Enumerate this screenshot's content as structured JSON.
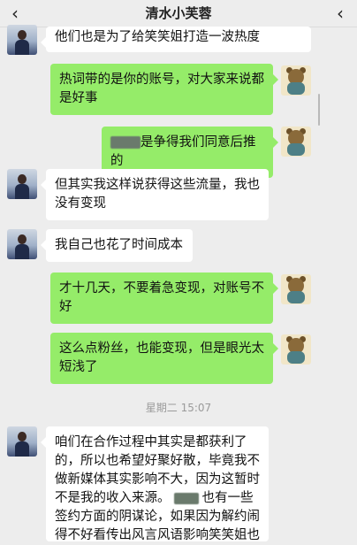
{
  "header": {
    "back_icon": "‹",
    "title": "清水小芙蓉",
    "right_icon": "‹"
  },
  "messages": [
    {
      "side": "left",
      "text": "他们也是为了给笑笑姐打造一波热度"
    },
    {
      "side": "right",
      "line1": "热词带的是你的账号，对大家来说都",
      "line2": "是好事"
    },
    {
      "side": "right",
      "text": "是争得我们同意后推的"
    },
    {
      "side": "left",
      "line1": "但其实我这样说获得这些流量，我也",
      "line2": "没有变现"
    },
    {
      "side": "left",
      "text": "我自己也花了时间成本"
    },
    {
      "side": "right",
      "line1": "才十几天，不要着急变现，对账号不",
      "line2": "好"
    },
    {
      "side": "right",
      "line1": "这么点粉丝，也能变现，但是眼光太",
      "line2": "短浅了"
    },
    {
      "side": "left",
      "line1": "咱们在合作过程中其实是都获利了",
      "line2": "的，所以也希望好聚好散，毕竟我不",
      "line3": "做新媒体其实影响不大，因为这暂时",
      "line4a": "不是我的收入来源。",
      "line4b": "也有一些",
      "line5": "签约方面的阴谋论，如果因为解约闹",
      "line6": "得不好看传出风言风语影响笑笑姐也"
    }
  ],
  "timestamp": "星期二 15:07",
  "colors": {
    "self_bubble": "#95ec69",
    "other_bubble": "#ffffff",
    "background": "#ededed"
  }
}
